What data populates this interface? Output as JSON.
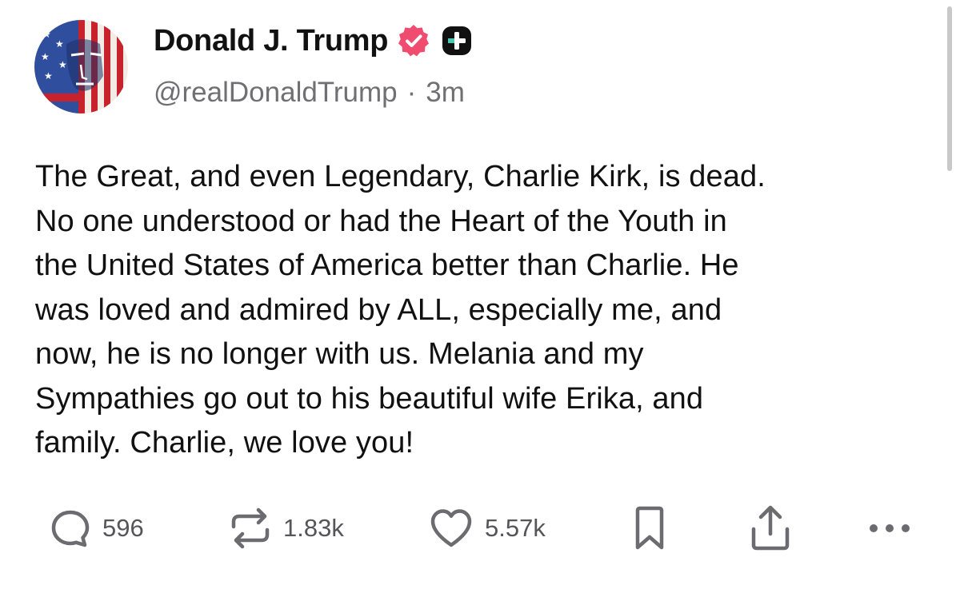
{
  "post": {
    "author": {
      "display_name": "Donald J. Trump",
      "handle": "@realDonaldTrump",
      "time_ago": "3m",
      "separator": "·"
    },
    "body_lines": [
      "The Great, and even Legendary, Charlie Kirk, is dead.",
      "No one understood or had the Heart of the Youth in",
      "the United States of America better than Charlie. He",
      "was loved and admired by ALL, especially me, and",
      "now, he is no longer with us. Melania and my",
      "Sympathies go out to his beautiful wife Erika, and",
      "family. Charlie, we love you!"
    ],
    "actions": {
      "replies": "596",
      "retruths": "1.83k",
      "likes": "5.57k"
    }
  },
  "icons": [
    "avatar",
    "verified-icon",
    "plus-badge-icon",
    "reply-icon",
    "retruth-icon",
    "like-icon",
    "bookmark-icon",
    "share-icon",
    "more-icon"
  ],
  "colors": {
    "verified_badge": "#ef4c6f",
    "plus_badge": "#111111",
    "secondary_text": "#6f6f74",
    "action_icon": "#6b6b70"
  }
}
